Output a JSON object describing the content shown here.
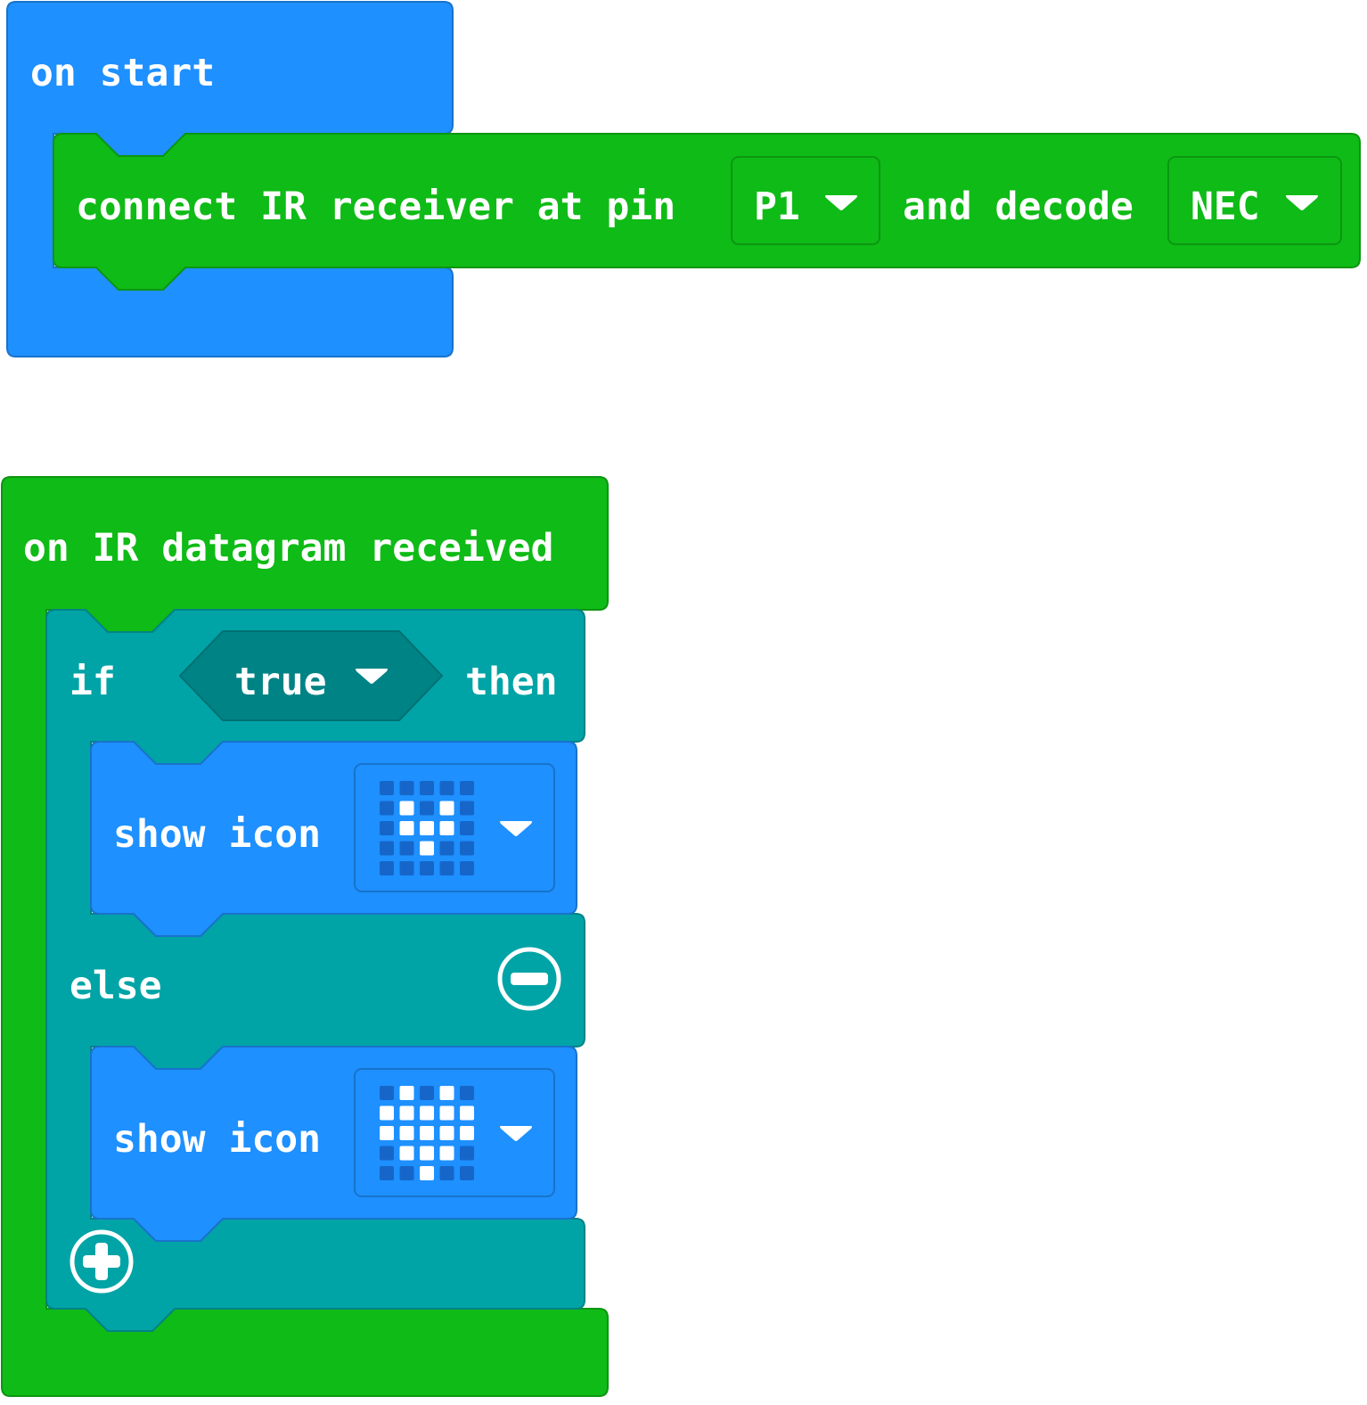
{
  "on_start": {
    "label": "on start",
    "connect": {
      "text_before": "connect IR receiver at pin",
      "pin_value": "P1",
      "text_middle": "and decode",
      "protocol_value": "NEC"
    }
  },
  "on_datagram": {
    "label": "on IR datagram received",
    "if_block": {
      "if_label": "if",
      "condition_value": "true",
      "then_label": "then",
      "else_label": "else",
      "then_action": {
        "label": "show icon",
        "icon_grid": [
          [
            0,
            0,
            0,
            0,
            0
          ],
          [
            0,
            1,
            0,
            1,
            0
          ],
          [
            0,
            1,
            1,
            1,
            0
          ],
          [
            0,
            0,
            1,
            0,
            0
          ],
          [
            0,
            0,
            0,
            0,
            0
          ]
        ]
      },
      "else_action": {
        "label": "show icon",
        "icon_grid": [
          [
            0,
            1,
            0,
            1,
            0
          ],
          [
            1,
            1,
            1,
            1,
            1
          ],
          [
            1,
            1,
            1,
            1,
            1
          ],
          [
            0,
            1,
            1,
            1,
            0
          ],
          [
            0,
            0,
            1,
            0,
            0
          ]
        ]
      }
    }
  },
  "icons": {
    "dropdown": "dropdown-arrow-icon",
    "remove_else": "minus-circle-icon",
    "add_else": "plus-circle-icon"
  },
  "colors": {
    "event_blue": "#1E90FF",
    "event_blue_border": "#1873CC",
    "ir_green": "#0FBB16",
    "ir_green_border": "#0C9612",
    "logic_teal": "#00A4A6",
    "logic_teal_border": "#008385",
    "logic_dark": "#008385",
    "led_on": "#FFFFFF",
    "led_off": "#1666C9"
  }
}
